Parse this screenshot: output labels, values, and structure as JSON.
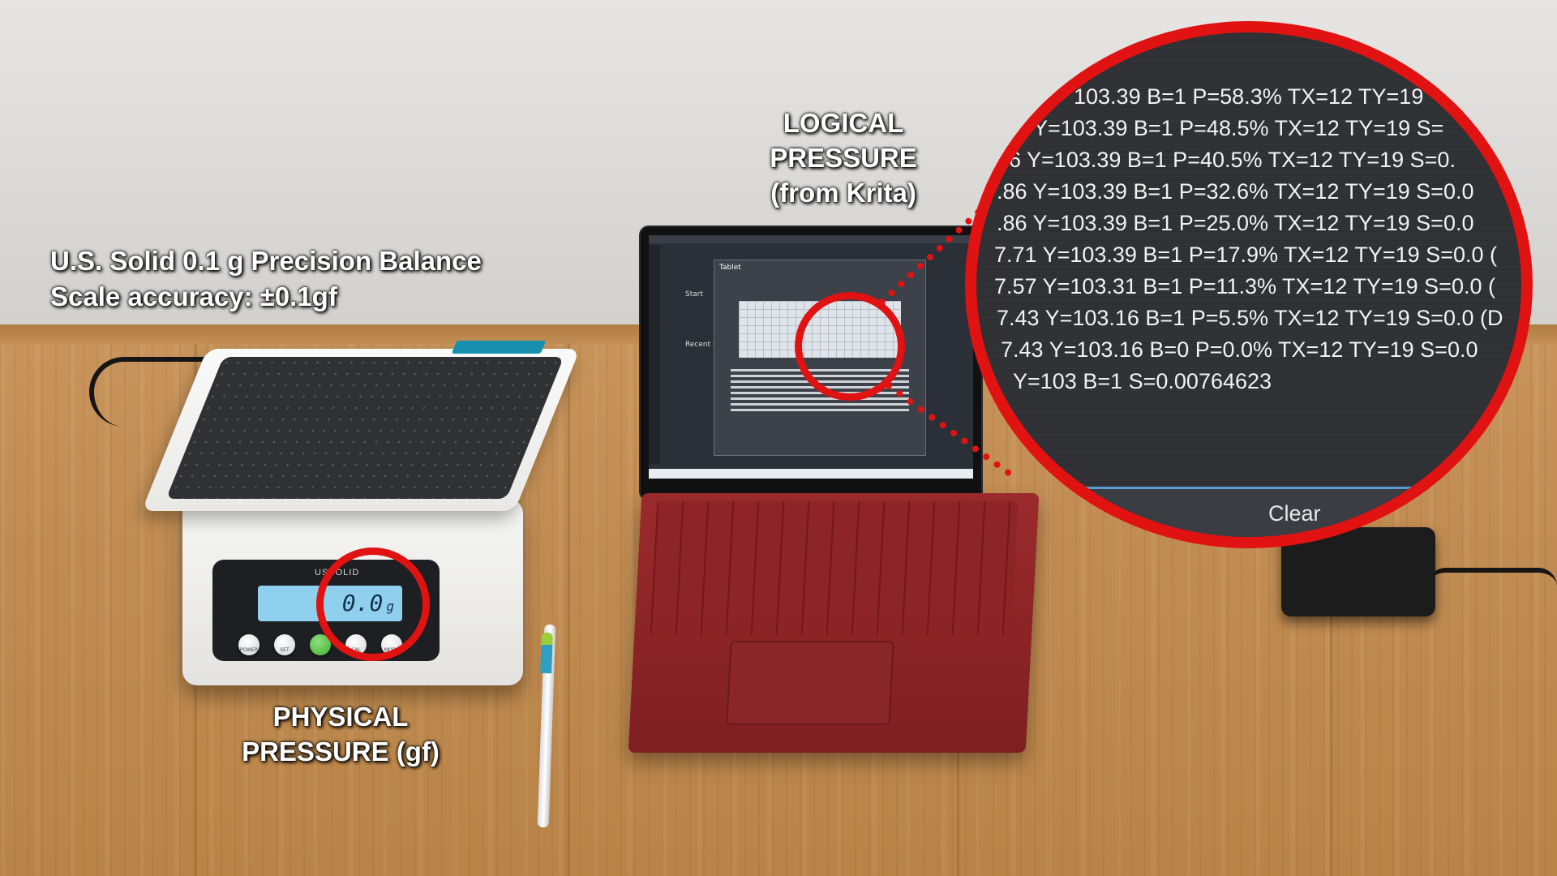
{
  "labels": {
    "balance_title": "U.S. Solid 0.1 g Precision Balance",
    "balance_accuracy": "Scale accuracy:  ±0.1gf",
    "logical_line1": "LOGICAL",
    "logical_line2": "PRESSURE",
    "logical_line3": "(from Krita)",
    "physical_line1": "PHYSICAL",
    "physical_line2": "PRESSURE (gf)"
  },
  "scale": {
    "brand": "USSOLID",
    "display_value": "0.0",
    "display_unit": "g",
    "buttons": [
      "POWER",
      "SET",
      "",
      "CAL",
      "MODE"
    ]
  },
  "krita": {
    "dialog_title": "Tablet",
    "start_label": "Start",
    "recent_label": "Recent D"
  },
  "zoom": {
    "log_lines": [
      "103.39 B=1 P=58.3% TX=12 TY=19",
      "Y=103.39 B=1 P=48.5% TX=12 TY=19 S=",
      "6 Y=103.39 B=1 P=40.5% TX=12 TY=19 S=0.",
      ".86 Y=103.39 B=1 P=32.6% TX=12 TY=19 S=0.0",
      ".86 Y=103.39 B=1 P=25.0% TX=12 TY=19 S=0.0",
      "7.71 Y=103.39 B=1 P=17.9% TX=12 TY=19 S=0.0 (",
      "7.57 Y=103.31 B=1 P=11.3% TX=12 TY=19 S=0.0 (",
      "7.43 Y=103.16 B=1 P=5.5% TX=12 TY=19 S=0.0 (D",
      "7.43 Y=103.16 B=0 P=0.0% TX=12 TY=19 S=0.0",
      "Y=103 B=1 S=0.00764623"
    ],
    "clear_button": "Clear"
  },
  "colors": {
    "callout_red": "#e01212",
    "lcd_blue": "#8fd0ef",
    "keyboard_red": "#8d2427"
  }
}
